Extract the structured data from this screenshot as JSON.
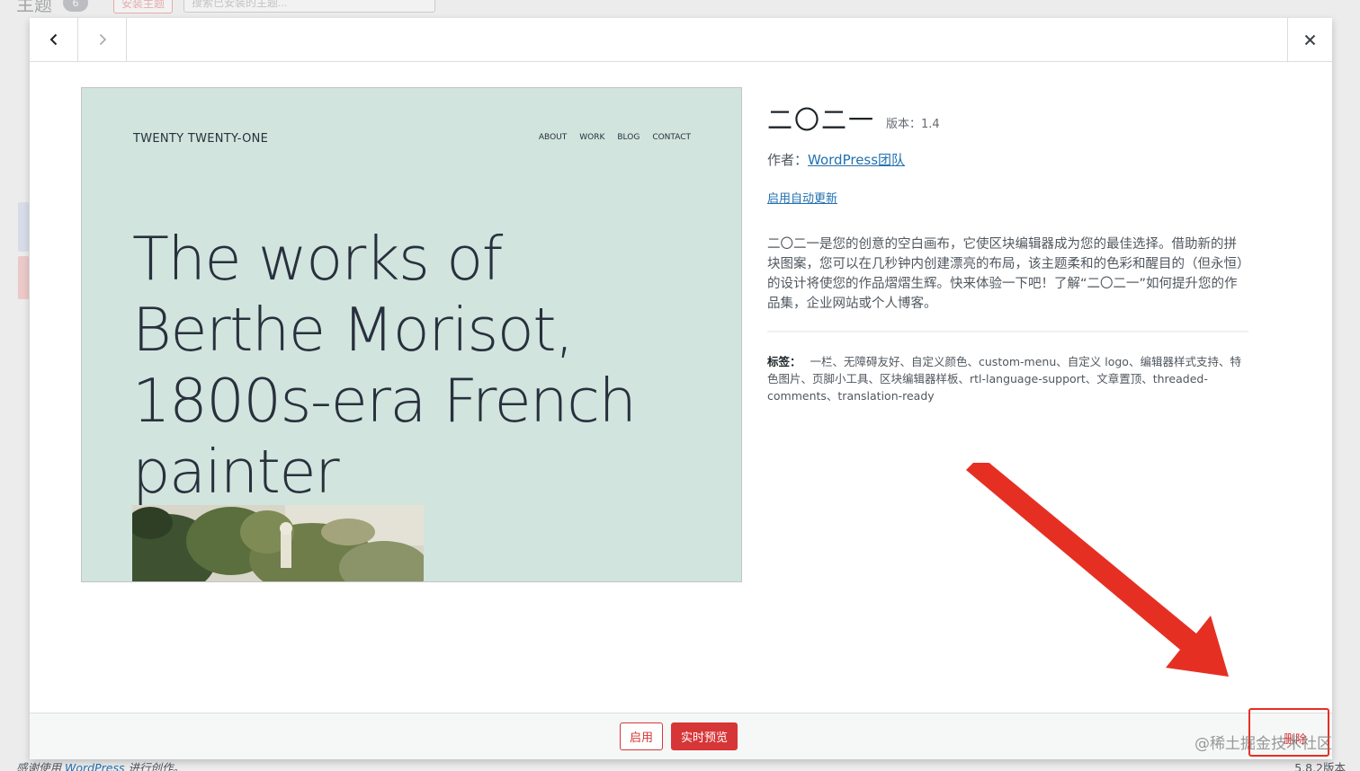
{
  "background": {
    "title": "主题",
    "count": "6",
    "add_button": "安装主题",
    "search_placeholder": "搜索已安装的主题...",
    "footer_prefix": "感谢使用",
    "footer_link": "WordPress",
    "footer_suffix": "进行创作。",
    "version": "5.8.2版本"
  },
  "modal": {
    "prev_icon": "chevron-left-icon",
    "next_icon": "chevron-right-icon",
    "close_icon": "close-icon"
  },
  "screenshot": {
    "site_title": "TWENTY TWENTY-ONE",
    "nav": [
      "ABOUT",
      "WORK",
      "BLOG",
      "CONTACT"
    ],
    "headline": "The works of Berthe Morisot, 1800s-era French painter",
    "bg_color": "#d1e4dd"
  },
  "theme": {
    "name": "二〇二一",
    "version_label": "版本：1.4",
    "author_prefix": "作者：",
    "author_name": "WordPress团队",
    "auto_update": "启用自动更新",
    "description": "二〇二一是您的创意的空白画布，它使区块编辑器成为您的最佳选择。借助新的拼块图案，您可以在几秒钟内创建漂亮的布局，该主题柔和的色彩和醒目的（但永恒）的设计将使您的作品熠熠生辉。快来体验一下吧！了解“二〇二一”如何提升您的作品集，企业网站或个人博客。",
    "tags_label": "标签：",
    "tags": "一栏、无障碍友好、自定义颜色、custom-menu、自定义 logo、编辑器样式支持、特色图片、页脚小工具、区块编辑器样板、rtl-language-support、文章置顶、threaded-comments、translation-ready"
  },
  "actions": {
    "activate": "启用",
    "live_preview": "实时预览",
    "delete": "删除"
  },
  "watermark": "@稀土掘金技术社区",
  "colors": {
    "accent_red": "#d63638",
    "link_blue": "#2271b1",
    "annotation_red": "#e62f23"
  }
}
